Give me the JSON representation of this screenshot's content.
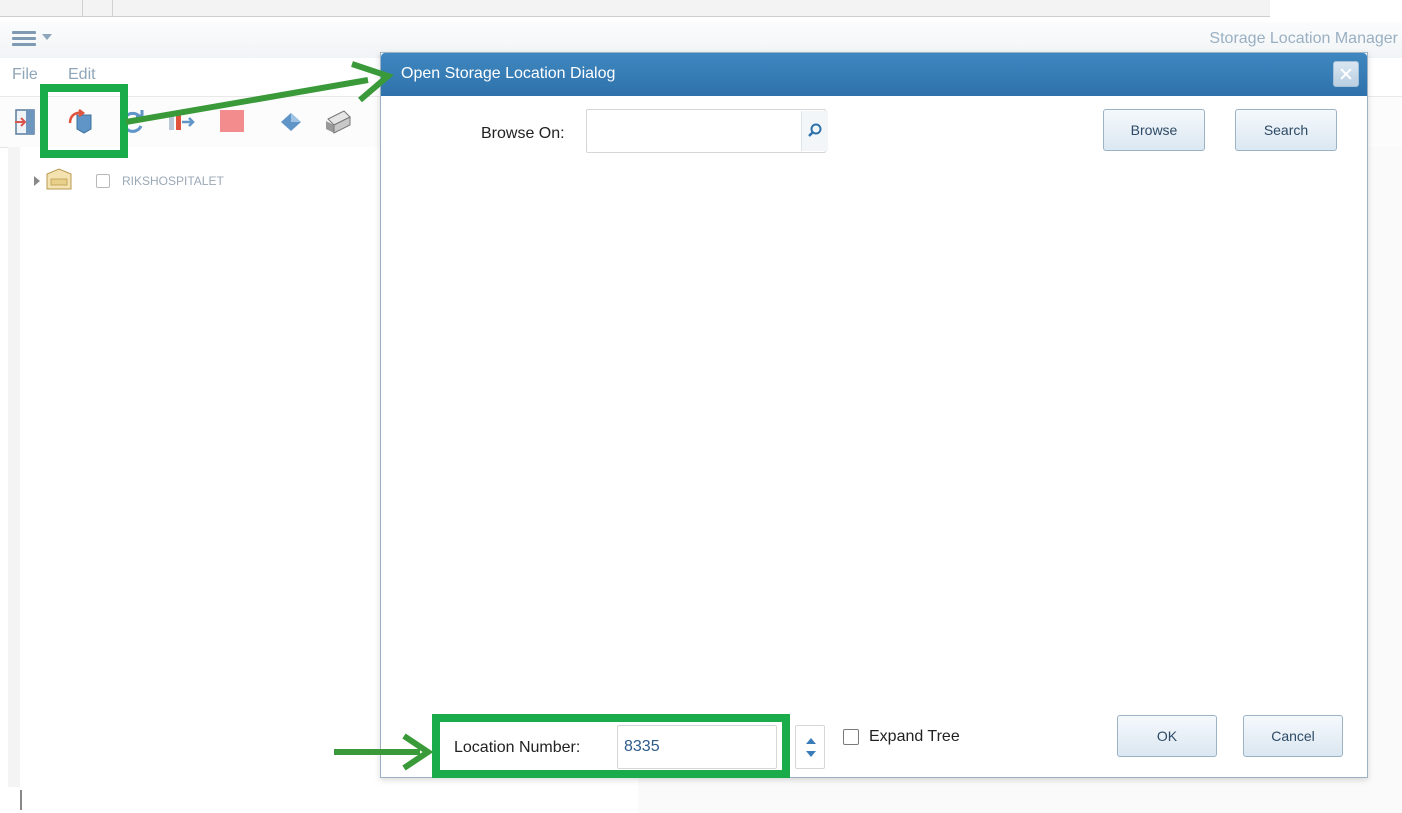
{
  "app": {
    "title": "Storage Location Manager"
  },
  "menu": {
    "file": "File",
    "edit": "Edit"
  },
  "toolbar": {
    "icons": [
      "import-icon",
      "open-location-icon",
      "refresh-icon",
      "transfer-icon",
      "stop-icon",
      "diamond-icon",
      "print-icon"
    ]
  },
  "tree": {
    "root_label": "RIKSHOSPITALET"
  },
  "dialog": {
    "title": "Open Storage Location Dialog",
    "browse_on_label": "Browse On:",
    "browse_on_value": "",
    "browse_button": "Browse",
    "search_button": "Search",
    "location_number_label": "Location Number:",
    "location_number_value": "8335",
    "expand_tree_label": "Expand Tree",
    "ok_button": "OK",
    "cancel_button": "Cancel"
  },
  "colors": {
    "dialog_header": "#2f72ab",
    "annotation_green": "#1aab4a",
    "app_title": "#9ab0c2"
  }
}
